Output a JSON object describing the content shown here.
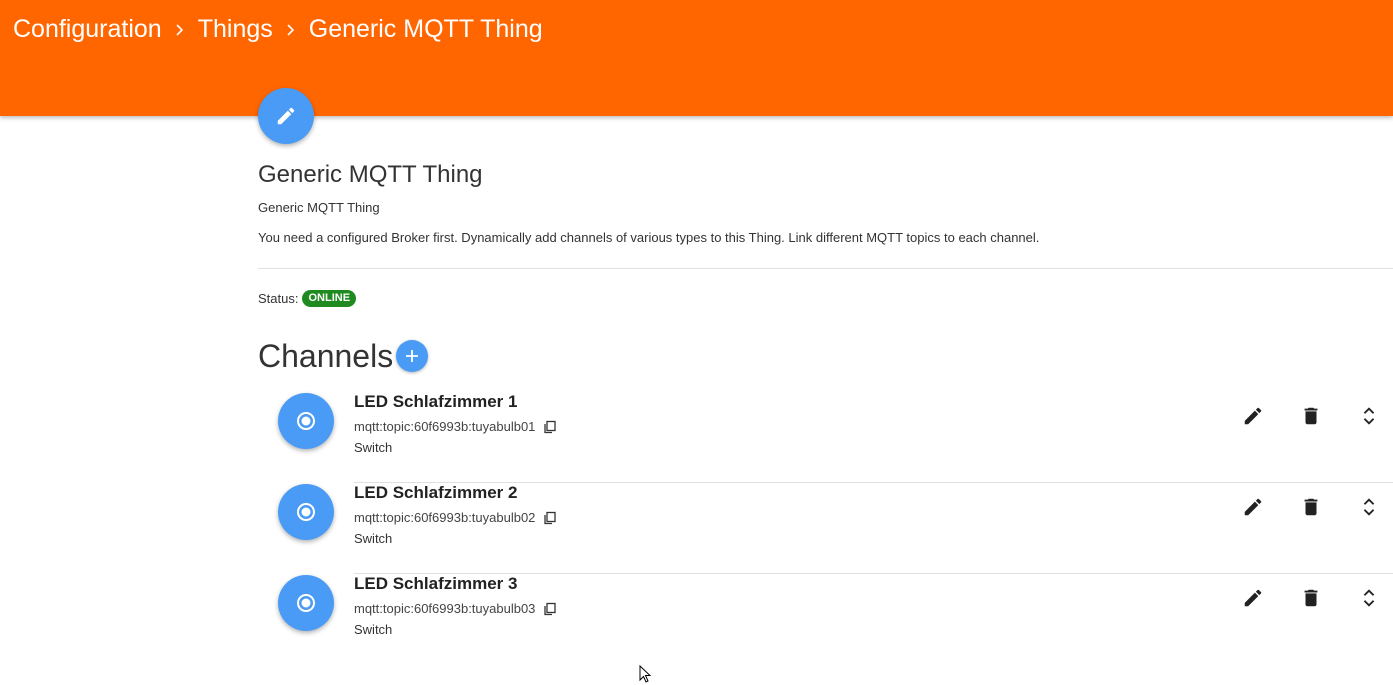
{
  "breadcrumb": {
    "items": [
      "Configuration",
      "Things",
      "Generic MQTT Thing"
    ]
  },
  "thing": {
    "title": "Generic MQTT Thing",
    "subtitle": "Generic MQTT Thing",
    "description": "You need a configured Broker first. Dynamically add channels of various types to this Thing. Link different MQTT topics to each channel.",
    "status_label": "Status:",
    "status_value": "ONLINE"
  },
  "channels": {
    "heading": "Channels",
    "items": [
      {
        "name": "LED Schlafzimmer 1",
        "uid": "mqtt:topic:60f6993b:tuyabulb01",
        "type": "Switch"
      },
      {
        "name": "LED Schlafzimmer 2",
        "uid": "mqtt:topic:60f6993b:tuyabulb02",
        "type": "Switch"
      },
      {
        "name": "LED Schlafzimmer 3",
        "uid": "mqtt:topic:60f6993b:tuyabulb03",
        "type": "Switch"
      }
    ]
  },
  "colors": {
    "header": "#ff6600",
    "accent": "#4a9bf5",
    "status_online": "#1f8a1f"
  },
  "icons": {
    "edit": "pencil-icon",
    "add": "plus-icon",
    "channel": "radio-button-icon",
    "copy": "copy-icon",
    "delete": "trash-icon",
    "expand": "unfold-icon"
  }
}
